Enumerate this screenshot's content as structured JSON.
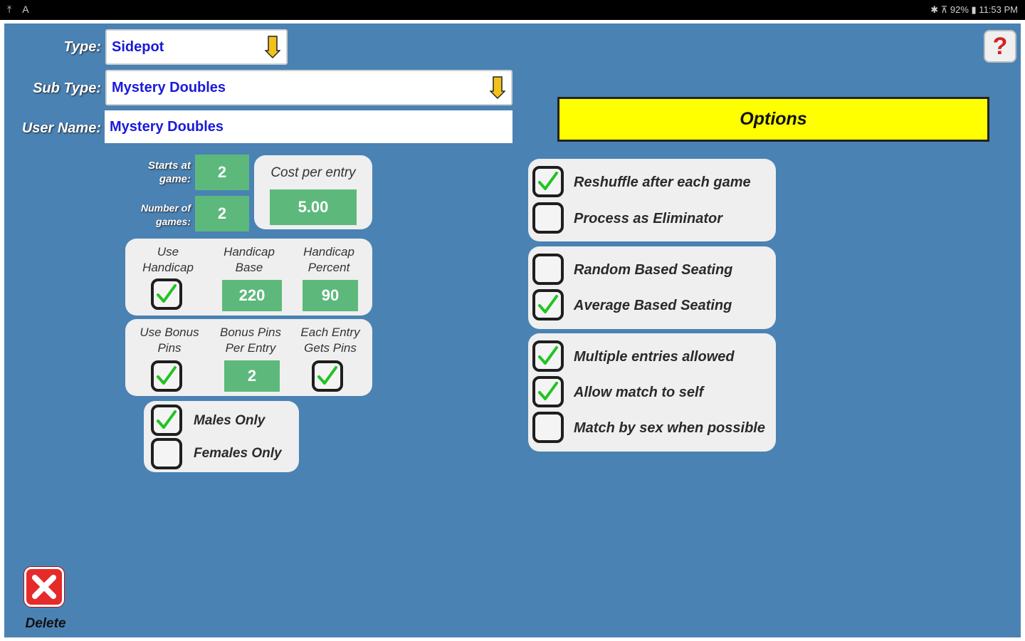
{
  "status_bar": {
    "left_icons": "⤒ A",
    "right_text": "✱ ⊼ 92% ▮ 11:53 PM"
  },
  "form": {
    "type_label": "Type:",
    "type_value": "Sidepot",
    "subtype_label": "Sub Type:",
    "subtype_value": "Mystery Doubles",
    "username_label": "User Name:",
    "username_value": "Mystery Doubles"
  },
  "games": {
    "starts_label": "Starts at game:",
    "starts_value": "2",
    "number_label": "Number of games:",
    "number_value": "2",
    "cost_label": "Cost per entry",
    "cost_value": "5.00"
  },
  "handicap": {
    "use_label": "Use Handicap",
    "use_checked": true,
    "base_label": "Handicap Base",
    "base_value": "220",
    "percent_label": "Handicap Percent",
    "percent_value": "90"
  },
  "bonus": {
    "use_label": "Use Bonus Pins",
    "use_checked": true,
    "per_entry_label": "Bonus Pins Per Entry",
    "per_entry_value": "2",
    "each_label": "Each Entry Gets Pins",
    "each_checked": true
  },
  "gender": {
    "males_label": "Males Only",
    "males_checked": true,
    "females_label": "Females Only",
    "females_checked": false
  },
  "options_title": "Options",
  "options": {
    "reshuffle_label": "Reshuffle after each game",
    "reshuffle_checked": true,
    "eliminator_label": "Process as Eliminator",
    "eliminator_checked": false,
    "random_label": "Random Based Seating",
    "random_checked": false,
    "average_label": "Average Based Seating",
    "average_checked": true,
    "multiple_label": "Multiple entries allowed",
    "multiple_checked": true,
    "self_label": "Allow match to self",
    "self_checked": true,
    "sex_label": "Match by sex when possible",
    "sex_checked": false
  },
  "help_label": "?",
  "delete_label": "Delete",
  "colors": {
    "background": "#4a82b4",
    "field_text": "#1a1adc",
    "value_box": "#5cb97b",
    "options_banner": "#ffff00",
    "check_mark": "#22c322",
    "delete": "#e52a2a"
  }
}
